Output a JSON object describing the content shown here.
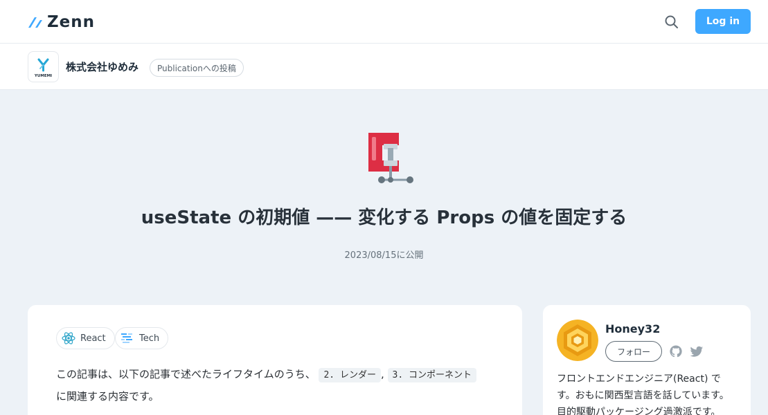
{
  "header": {
    "logo_text": "Zenn",
    "login_label": "Log in"
  },
  "publication": {
    "logo_text": "YUMEMI",
    "name": "株式会社ゆめみ",
    "badge": "Publicationへの投稿"
  },
  "article": {
    "emoji": "clamp-icon",
    "title": "useState の初期値 —— 変化する Props の値を固定する",
    "published": "2023/08/15に公開",
    "topics": [
      {
        "label": "React",
        "icon": "react-icon"
      },
      {
        "label": "Tech",
        "icon": "tech-icon"
      }
    ],
    "body": {
      "line1_text": "この記事は、以下の記事で述べたライフタイムのうち、",
      "code1": "2. レンダー",
      "comma": ",",
      "code2": "3. コンポーネント",
      "line2_text": "に関連する内容です。"
    }
  },
  "author": {
    "name": "Honey32",
    "follow_label": "フォロー",
    "bio": "フロントエンドエンジニア(React) です。おもに関西型言語を話しています。目的駆動パッケージング過激派です。"
  },
  "colors": {
    "accent": "#3ea8ff",
    "background": "#edf2f7",
    "clamp_red": "#dd2e44"
  }
}
